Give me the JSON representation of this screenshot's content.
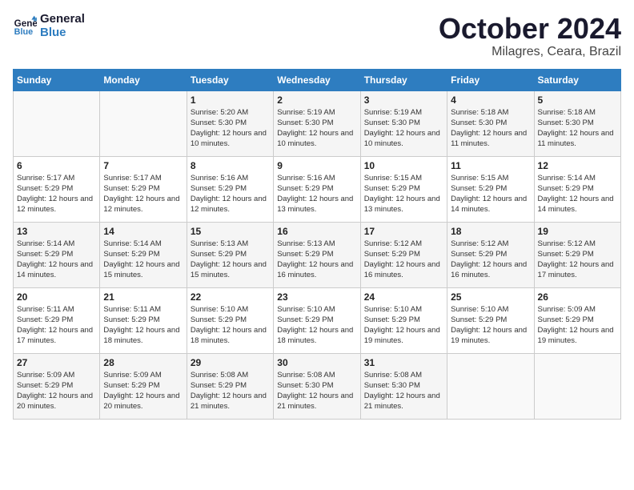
{
  "header": {
    "logo_line1": "General",
    "logo_line2": "Blue",
    "month": "October 2024",
    "location": "Milagres, Ceara, Brazil"
  },
  "weekdays": [
    "Sunday",
    "Monday",
    "Tuesday",
    "Wednesday",
    "Thursday",
    "Friday",
    "Saturday"
  ],
  "weeks": [
    [
      {
        "day": "",
        "sunrise": "",
        "sunset": "",
        "daylight": ""
      },
      {
        "day": "",
        "sunrise": "",
        "sunset": "",
        "daylight": ""
      },
      {
        "day": "1",
        "sunrise": "Sunrise: 5:20 AM",
        "sunset": "Sunset: 5:30 PM",
        "daylight": "Daylight: 12 hours and 10 minutes."
      },
      {
        "day": "2",
        "sunrise": "Sunrise: 5:19 AM",
        "sunset": "Sunset: 5:30 PM",
        "daylight": "Daylight: 12 hours and 10 minutes."
      },
      {
        "day": "3",
        "sunrise": "Sunrise: 5:19 AM",
        "sunset": "Sunset: 5:30 PM",
        "daylight": "Daylight: 12 hours and 10 minutes."
      },
      {
        "day": "4",
        "sunrise": "Sunrise: 5:18 AM",
        "sunset": "Sunset: 5:30 PM",
        "daylight": "Daylight: 12 hours and 11 minutes."
      },
      {
        "day": "5",
        "sunrise": "Sunrise: 5:18 AM",
        "sunset": "Sunset: 5:30 PM",
        "daylight": "Daylight: 12 hours and 11 minutes."
      }
    ],
    [
      {
        "day": "6",
        "sunrise": "Sunrise: 5:17 AM",
        "sunset": "Sunset: 5:29 PM",
        "daylight": "Daylight: 12 hours and 12 minutes."
      },
      {
        "day": "7",
        "sunrise": "Sunrise: 5:17 AM",
        "sunset": "Sunset: 5:29 PM",
        "daylight": "Daylight: 12 hours and 12 minutes."
      },
      {
        "day": "8",
        "sunrise": "Sunrise: 5:16 AM",
        "sunset": "Sunset: 5:29 PM",
        "daylight": "Daylight: 12 hours and 12 minutes."
      },
      {
        "day": "9",
        "sunrise": "Sunrise: 5:16 AM",
        "sunset": "Sunset: 5:29 PM",
        "daylight": "Daylight: 12 hours and 13 minutes."
      },
      {
        "day": "10",
        "sunrise": "Sunrise: 5:15 AM",
        "sunset": "Sunset: 5:29 PM",
        "daylight": "Daylight: 12 hours and 13 minutes."
      },
      {
        "day": "11",
        "sunrise": "Sunrise: 5:15 AM",
        "sunset": "Sunset: 5:29 PM",
        "daylight": "Daylight: 12 hours and 14 minutes."
      },
      {
        "day": "12",
        "sunrise": "Sunrise: 5:14 AM",
        "sunset": "Sunset: 5:29 PM",
        "daylight": "Daylight: 12 hours and 14 minutes."
      }
    ],
    [
      {
        "day": "13",
        "sunrise": "Sunrise: 5:14 AM",
        "sunset": "Sunset: 5:29 PM",
        "daylight": "Daylight: 12 hours and 14 minutes."
      },
      {
        "day": "14",
        "sunrise": "Sunrise: 5:14 AM",
        "sunset": "Sunset: 5:29 PM",
        "daylight": "Daylight: 12 hours and 15 minutes."
      },
      {
        "day": "15",
        "sunrise": "Sunrise: 5:13 AM",
        "sunset": "Sunset: 5:29 PM",
        "daylight": "Daylight: 12 hours and 15 minutes."
      },
      {
        "day": "16",
        "sunrise": "Sunrise: 5:13 AM",
        "sunset": "Sunset: 5:29 PM",
        "daylight": "Daylight: 12 hours and 16 minutes."
      },
      {
        "day": "17",
        "sunrise": "Sunrise: 5:12 AM",
        "sunset": "Sunset: 5:29 PM",
        "daylight": "Daylight: 12 hours and 16 minutes."
      },
      {
        "day": "18",
        "sunrise": "Sunrise: 5:12 AM",
        "sunset": "Sunset: 5:29 PM",
        "daylight": "Daylight: 12 hours and 16 minutes."
      },
      {
        "day": "19",
        "sunrise": "Sunrise: 5:12 AM",
        "sunset": "Sunset: 5:29 PM",
        "daylight": "Daylight: 12 hours and 17 minutes."
      }
    ],
    [
      {
        "day": "20",
        "sunrise": "Sunrise: 5:11 AM",
        "sunset": "Sunset: 5:29 PM",
        "daylight": "Daylight: 12 hours and 17 minutes."
      },
      {
        "day": "21",
        "sunrise": "Sunrise: 5:11 AM",
        "sunset": "Sunset: 5:29 PM",
        "daylight": "Daylight: 12 hours and 18 minutes."
      },
      {
        "day": "22",
        "sunrise": "Sunrise: 5:10 AM",
        "sunset": "Sunset: 5:29 PM",
        "daylight": "Daylight: 12 hours and 18 minutes."
      },
      {
        "day": "23",
        "sunrise": "Sunrise: 5:10 AM",
        "sunset": "Sunset: 5:29 PM",
        "daylight": "Daylight: 12 hours and 18 minutes."
      },
      {
        "day": "24",
        "sunrise": "Sunrise: 5:10 AM",
        "sunset": "Sunset: 5:29 PM",
        "daylight": "Daylight: 12 hours and 19 minutes."
      },
      {
        "day": "25",
        "sunrise": "Sunrise: 5:10 AM",
        "sunset": "Sunset: 5:29 PM",
        "daylight": "Daylight: 12 hours and 19 minutes."
      },
      {
        "day": "26",
        "sunrise": "Sunrise: 5:09 AM",
        "sunset": "Sunset: 5:29 PM",
        "daylight": "Daylight: 12 hours and 19 minutes."
      }
    ],
    [
      {
        "day": "27",
        "sunrise": "Sunrise: 5:09 AM",
        "sunset": "Sunset: 5:29 PM",
        "daylight": "Daylight: 12 hours and 20 minutes."
      },
      {
        "day": "28",
        "sunrise": "Sunrise: 5:09 AM",
        "sunset": "Sunset: 5:29 PM",
        "daylight": "Daylight: 12 hours and 20 minutes."
      },
      {
        "day": "29",
        "sunrise": "Sunrise: 5:08 AM",
        "sunset": "Sunset: 5:29 PM",
        "daylight": "Daylight: 12 hours and 21 minutes."
      },
      {
        "day": "30",
        "sunrise": "Sunrise: 5:08 AM",
        "sunset": "Sunset: 5:30 PM",
        "daylight": "Daylight: 12 hours and 21 minutes."
      },
      {
        "day": "31",
        "sunrise": "Sunrise: 5:08 AM",
        "sunset": "Sunset: 5:30 PM",
        "daylight": "Daylight: 12 hours and 21 minutes."
      },
      {
        "day": "",
        "sunrise": "",
        "sunset": "",
        "daylight": ""
      },
      {
        "day": "",
        "sunrise": "",
        "sunset": "",
        "daylight": ""
      }
    ]
  ]
}
